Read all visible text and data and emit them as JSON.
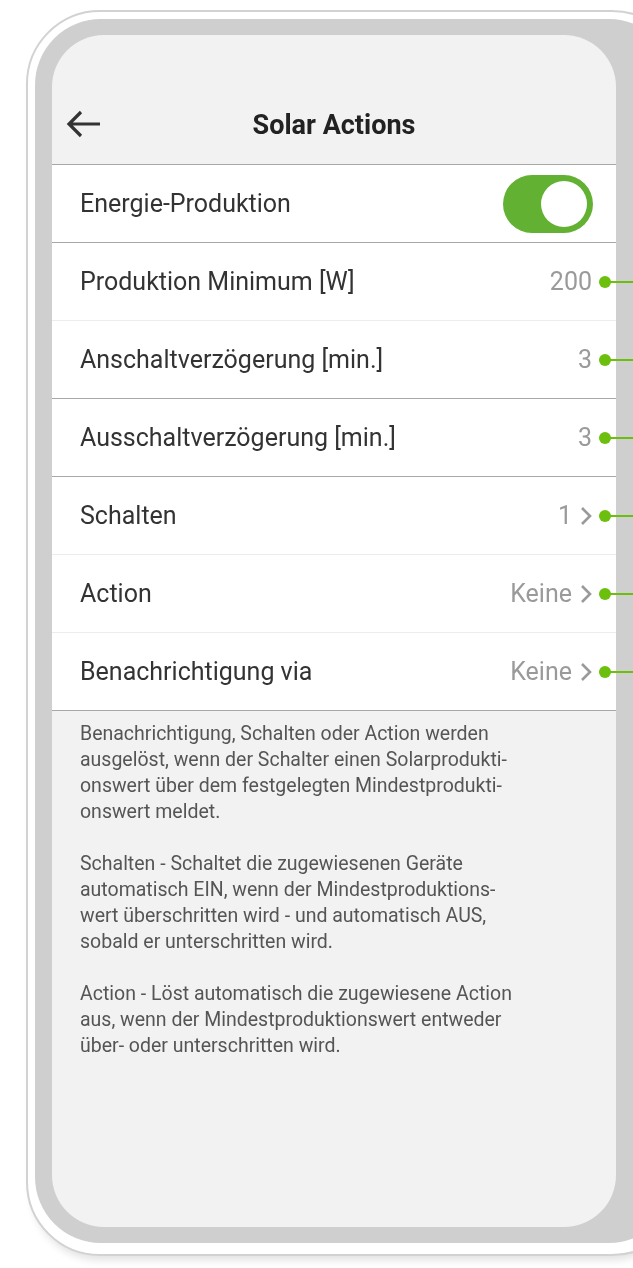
{
  "header": {
    "title": "Solar Actions"
  },
  "groups": [
    {
      "rows": [
        {
          "kind": "toggle",
          "label": "Energie-Produktion",
          "on": true
        }
      ]
    },
    {
      "rows": [
        {
          "kind": "value",
          "label": "Produktion Minimum [W]",
          "value": "200",
          "marked": true
        },
        {
          "kind": "value",
          "label": "Anschaltverzögerung [min.]",
          "value": "3",
          "marked": true
        }
      ]
    },
    {
      "rows": [
        {
          "kind": "value",
          "label": "Ausschaltverzögerung [min.]",
          "value": "3",
          "marked": true
        }
      ]
    },
    {
      "rows": [
        {
          "kind": "link",
          "label": "Schalten",
          "value": "1",
          "marked": true
        },
        {
          "kind": "link",
          "label": "Action",
          "value": "Keine",
          "marked": true
        },
        {
          "kind": "link",
          "label": "Benachrichtigung via",
          "value": "Keine",
          "marked": true
        }
      ]
    }
  ],
  "notes": [
    "Benachrichtigung, Schalten oder Action werden\nausgelöst, wenn der Schalter einen Solarprodukti-\nonswert über dem festgelegten Mindestprodukti-\nonswert meldet.",
    "Schalten - Schaltet die zugewiesenen Geräte\nautomatisch EIN, wenn der Mindestproduktions-\nwert überschritten wird - und automatisch AUS,\nsobald er unterschritten wird.",
    "Action - Löst automatisch die zugewiesene Action\naus, wenn der Mindestproduktionswert entweder\nüber- oder unterschritten wird."
  ]
}
